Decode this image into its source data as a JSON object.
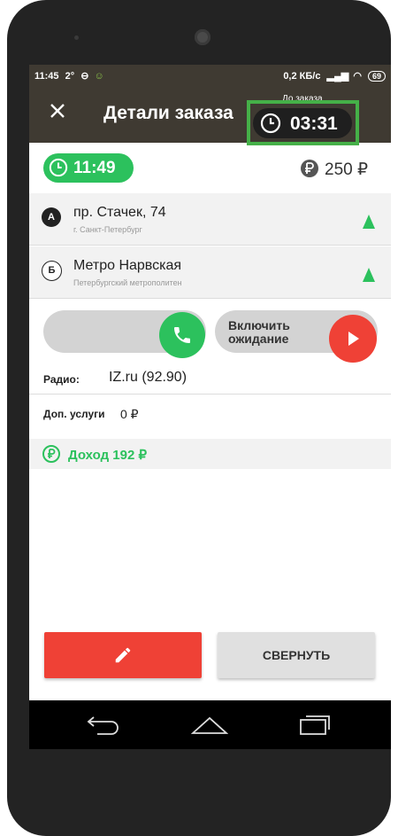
{
  "status_bar": {
    "time": "11:45",
    "temp": "2°",
    "network_speed": "0,2 КБ/с",
    "battery": "69"
  },
  "app_bar": {
    "title": "Детали заказа",
    "timer_label": "До заказа",
    "timer_value": "03:31"
  },
  "order": {
    "time": "11:49",
    "price": "250 ₽"
  },
  "addresses": [
    {
      "marker": "А",
      "main": "пр. Стачек, 74",
      "sub": "г. Санкт-Петербург"
    },
    {
      "marker": "Б",
      "main": "Метро Нарвская",
      "sub": "Петербургский метрополитен"
    }
  ],
  "actions": {
    "wait_label_line1": "Включить",
    "wait_label_line2": "ожидание"
  },
  "radio": {
    "label": "Радио:",
    "value": "IZ.ru (92.90)"
  },
  "extra_services": {
    "label": "Доп. услуги",
    "value": "0 ₽"
  },
  "income": {
    "label": "Доход 192 ₽"
  },
  "buttons": {
    "collapse": "СВЕРНУТЬ"
  },
  "colors": {
    "accent_green": "#2cc15d",
    "danger_red": "#ef4136",
    "appbar": "#3f3a32",
    "highlight_box": "#45b048"
  }
}
